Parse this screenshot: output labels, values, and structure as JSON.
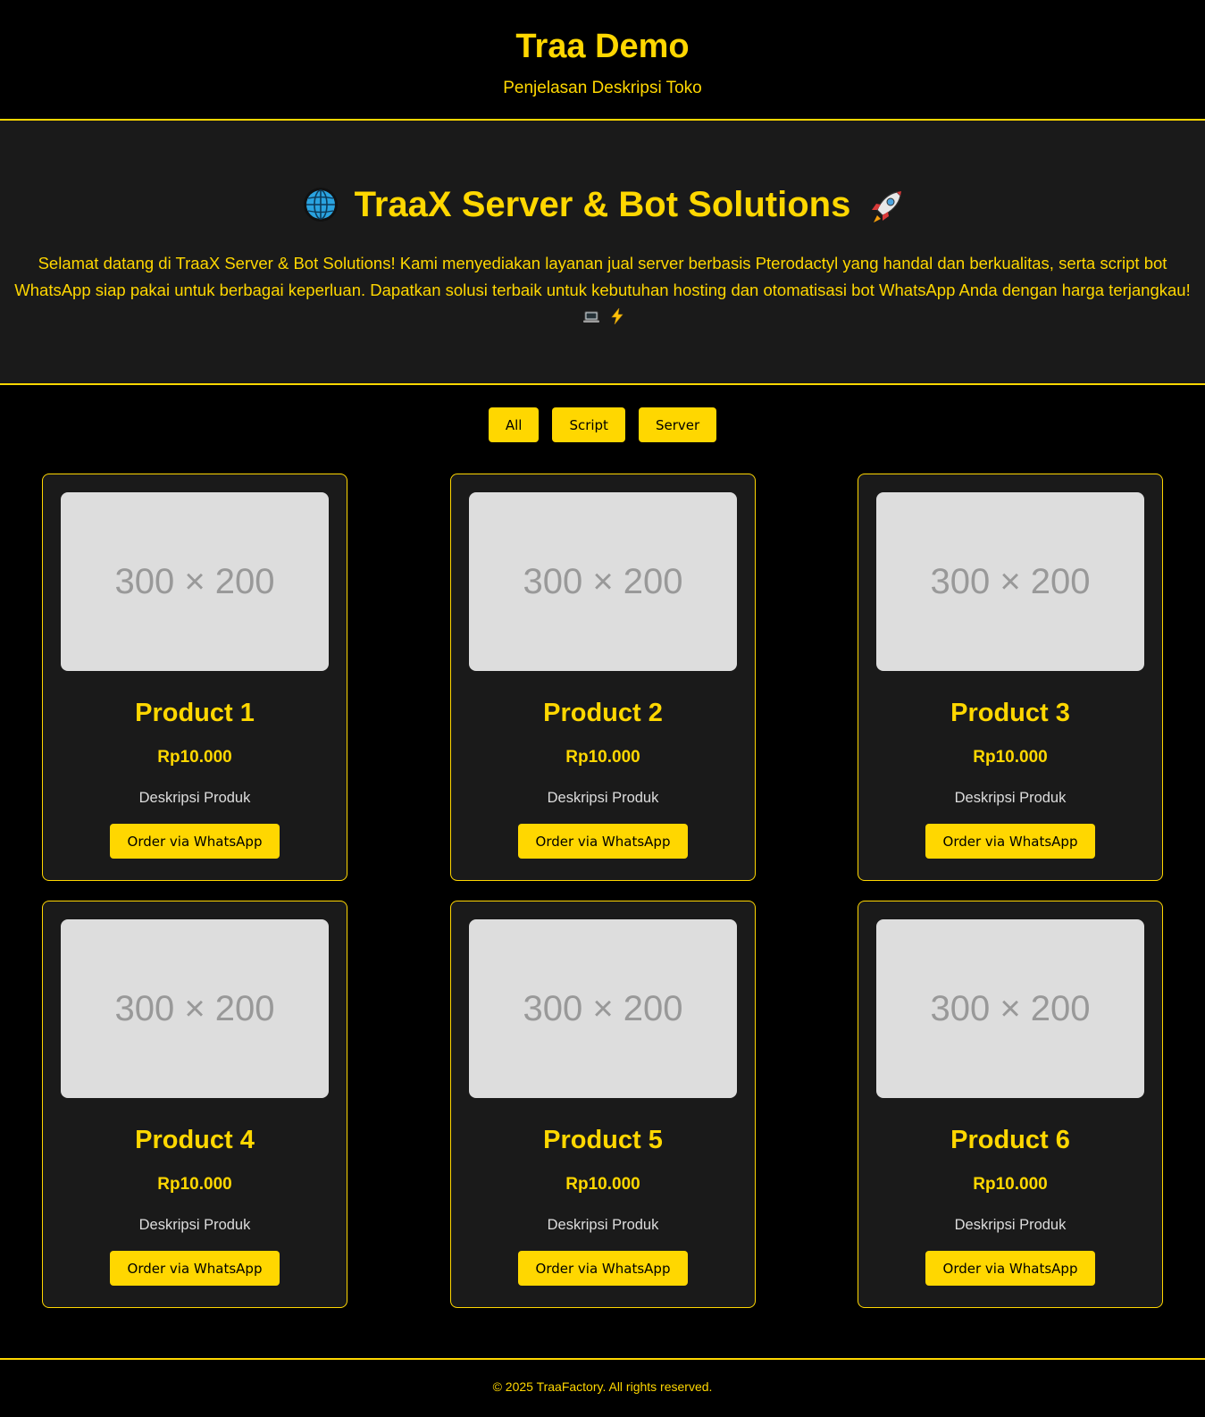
{
  "header": {
    "title": "Traa Demo",
    "subtitle": "Penjelasan Deskripsi Toko"
  },
  "hero": {
    "title": "TraaX Server & Bot Solutions",
    "leading_icon": "globe-icon",
    "trailing_icon": "rocket-icon",
    "text": "Selamat datang di TraaX Server & Bot Solutions! Kami menyediakan layanan jual server berbasis Pterodactyl yang handal dan berkualitas, serta script bot WhatsApp siap pakai untuk berbagai keperluan. Dapatkan solusi terbaik untuk kebutuhan hosting dan otomatisasi bot WhatsApp Anda dengan harga terjangkau!",
    "text_icons": [
      "laptop-icon",
      "lightning-icon"
    ]
  },
  "filters": [
    {
      "label": "All"
    },
    {
      "label": "Script"
    },
    {
      "label": "Server"
    }
  ],
  "products": [
    {
      "image_text": "300 × 200",
      "name": "Product 1",
      "price": "Rp10.000",
      "description": "Deskripsi Produk",
      "button": "Order via WhatsApp"
    },
    {
      "image_text": "300 × 200",
      "name": "Product 2",
      "price": "Rp10.000",
      "description": "Deskripsi Produk",
      "button": "Order via WhatsApp"
    },
    {
      "image_text": "300 × 200",
      "name": "Product 3",
      "price": "Rp10.000",
      "description": "Deskripsi Produk",
      "button": "Order via WhatsApp"
    },
    {
      "image_text": "300 × 200",
      "name": "Product 4",
      "price": "Rp10.000",
      "description": "Deskripsi Produk",
      "button": "Order via WhatsApp"
    },
    {
      "image_text": "300 × 200",
      "name": "Product 5",
      "price": "Rp10.000",
      "description": "Deskripsi Produk",
      "button": "Order via WhatsApp"
    },
    {
      "image_text": "300 × 200",
      "name": "Product 6",
      "price": "Rp10.000",
      "description": "Deskripsi Produk",
      "button": "Order via WhatsApp"
    }
  ],
  "footer": {
    "text": "© 2025 TraaFactory. All rights reserved."
  },
  "colors": {
    "accent": "#ffd700",
    "background": "#000000",
    "panel": "#1a1a1a",
    "placeholder": "#dddddd"
  }
}
